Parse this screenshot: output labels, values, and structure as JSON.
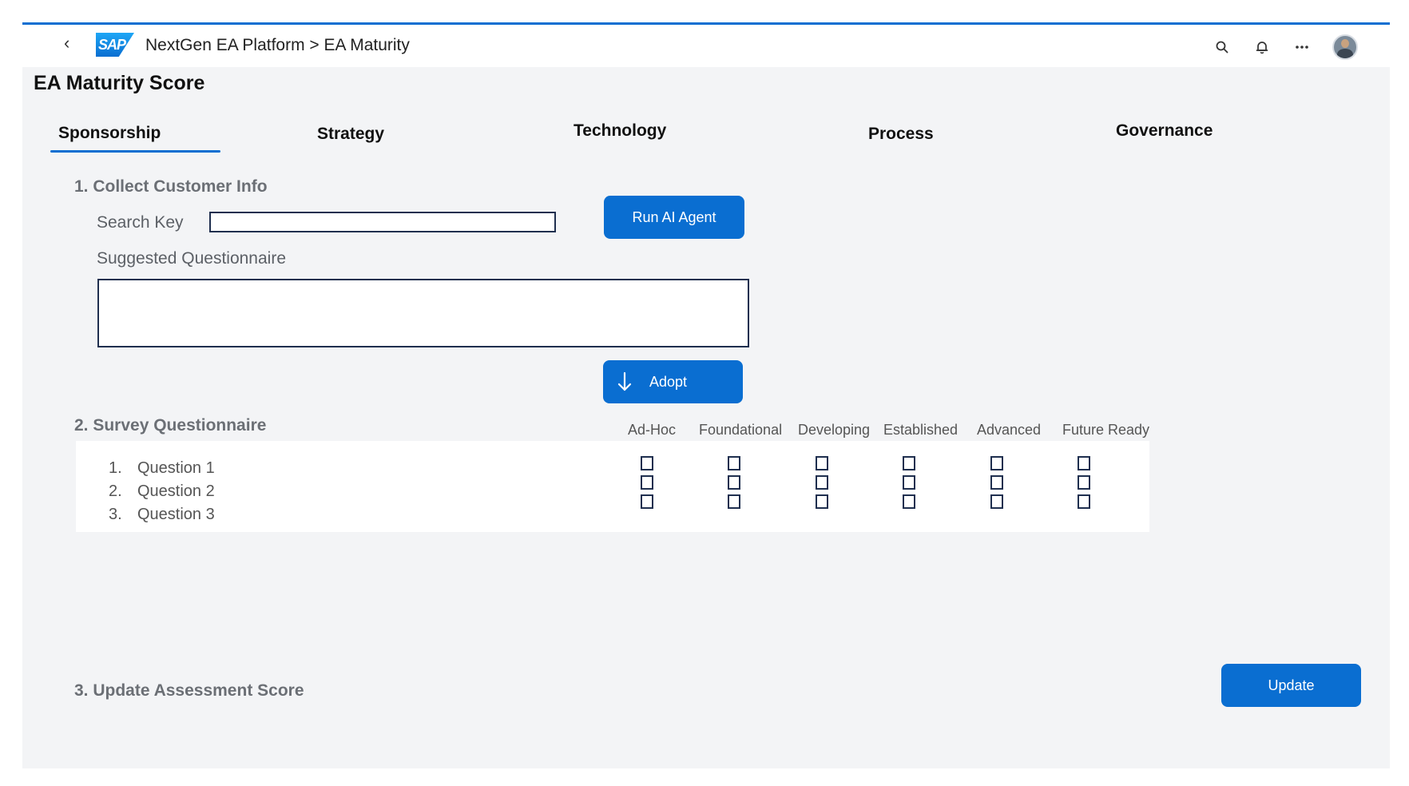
{
  "shell": {
    "breadcrumb": "NextGen EA Platform > EA Maturity",
    "logo_text": "SAP",
    "back_glyph": "‹",
    "icons": [
      "search-icon",
      "bell-icon",
      "overflow-icon",
      "avatar"
    ]
  },
  "page": {
    "title": "EA Maturity Score"
  },
  "tabs": [
    {
      "label": "Sponsorship",
      "selected": true
    },
    {
      "label": "Strategy"
    },
    {
      "label": "Technology"
    },
    {
      "label": "Process"
    },
    {
      "label": "Governance"
    }
  ],
  "collect": {
    "heading": "1. Collect Customer Info",
    "search_label": "Search Key",
    "search_value": "",
    "run_button": "Run AI Agent",
    "questionnaire_label": "Suggested Questionnaire",
    "questionnaire_value": "",
    "adopt_button": "Adopt"
  },
  "survey": {
    "heading": "2. Survey Questionnaire",
    "levels": [
      "Ad-Hoc",
      "Foundational",
      "Developing",
      "Established",
      "Advanced",
      "Future Ready"
    ],
    "questions": [
      {
        "num": "1.",
        "text": "Question 1"
      },
      {
        "num": "2.",
        "text": "Question 2"
      },
      {
        "num": "3.",
        "text": "Question 3"
      }
    ]
  },
  "update": {
    "heading": "3. Update Assessment Score",
    "button": "Update"
  },
  "colors": {
    "accent": "#0a6ed1",
    "background": "#f3f4f6",
    "border": "#1f2f4f"
  }
}
